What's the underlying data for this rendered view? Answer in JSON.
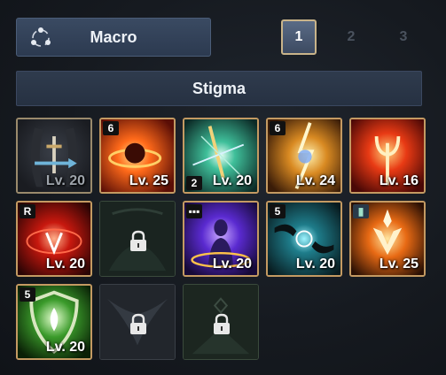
{
  "macro": {
    "label": "Macro",
    "icon": "share-nodes-icon"
  },
  "page_tabs": [
    {
      "label": "1",
      "active": true
    },
    {
      "label": "2",
      "active": false
    },
    {
      "label": "3",
      "active": false
    }
  ],
  "section": {
    "title": "Stigma"
  },
  "slots": [
    {
      "name": "stigma-slot-1",
      "level": "Lv. 20",
      "badge": "",
      "badge_bottom": "",
      "locked": false,
      "dim": true
    },
    {
      "name": "stigma-slot-2",
      "level": "Lv. 25",
      "badge": "6",
      "badge_bottom": "",
      "locked": false
    },
    {
      "name": "stigma-slot-3",
      "level": "Lv. 20",
      "badge": "",
      "badge_bottom": "2",
      "locked": false
    },
    {
      "name": "stigma-slot-4",
      "level": "Lv. 24",
      "badge": "6",
      "badge_bottom": "",
      "locked": false
    },
    {
      "name": "stigma-slot-5",
      "level": "Lv. 16",
      "badge": "",
      "badge_bottom": "",
      "locked": false
    },
    {
      "name": "stigma-slot-6",
      "level": "Lv. 20",
      "badge": "R",
      "badge_bottom": "",
      "locked": false
    },
    {
      "name": "stigma-slot-7",
      "level": "",
      "badge": "",
      "badge_bottom": "",
      "locked": true
    },
    {
      "name": "stigma-slot-8",
      "level": "Lv. 20",
      "badge": "▪▪▪",
      "badge_bottom": "",
      "locked": false
    },
    {
      "name": "stigma-slot-9",
      "level": "Lv. 20",
      "badge": "5",
      "badge_bottom": "",
      "locked": false
    },
    {
      "name": "stigma-slot-10",
      "level": "Lv. 25",
      "badge": "▮",
      "badge_bottom": "",
      "locked": false
    },
    {
      "name": "stigma-slot-11",
      "level": "Lv. 20",
      "badge": "5",
      "badge_bottom": "",
      "locked": false
    },
    {
      "name": "stigma-slot-12",
      "level": "",
      "badge": "",
      "badge_bottom": "",
      "locked": true
    },
    {
      "name": "stigma-slot-13",
      "level": "",
      "badge": "",
      "badge_bottom": "",
      "locked": true
    }
  ],
  "colors": {
    "accent_border": "#c49a62",
    "active_tab_border": "#c9b48a",
    "button_bg": "#33425a"
  }
}
